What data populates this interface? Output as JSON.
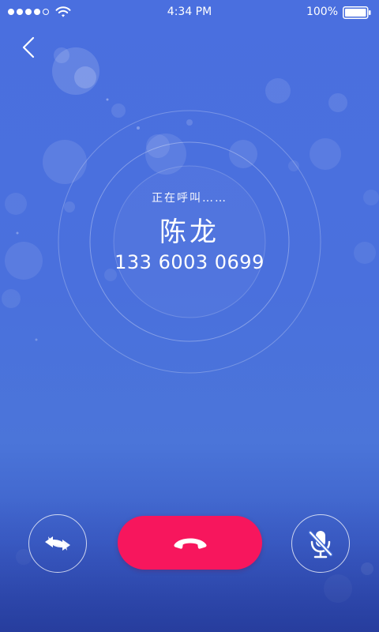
{
  "status_bar": {
    "signal_bars_filled": 4,
    "signal_bars_total": 5,
    "time": "4:34 PM",
    "battery_percent": "100%"
  },
  "call": {
    "status": "正在呼叫……",
    "caller_name": "陈龙",
    "caller_number": "133 6003 0699"
  },
  "controls": {
    "left_icon": "switch-arrows-icon",
    "center_icon": "hang-up-phone-icon",
    "right_icon": "microphone-muted-icon"
  },
  "colors": {
    "background": "#4a6fdf",
    "hangup": "#f7165d",
    "text": "#ffffff"
  }
}
